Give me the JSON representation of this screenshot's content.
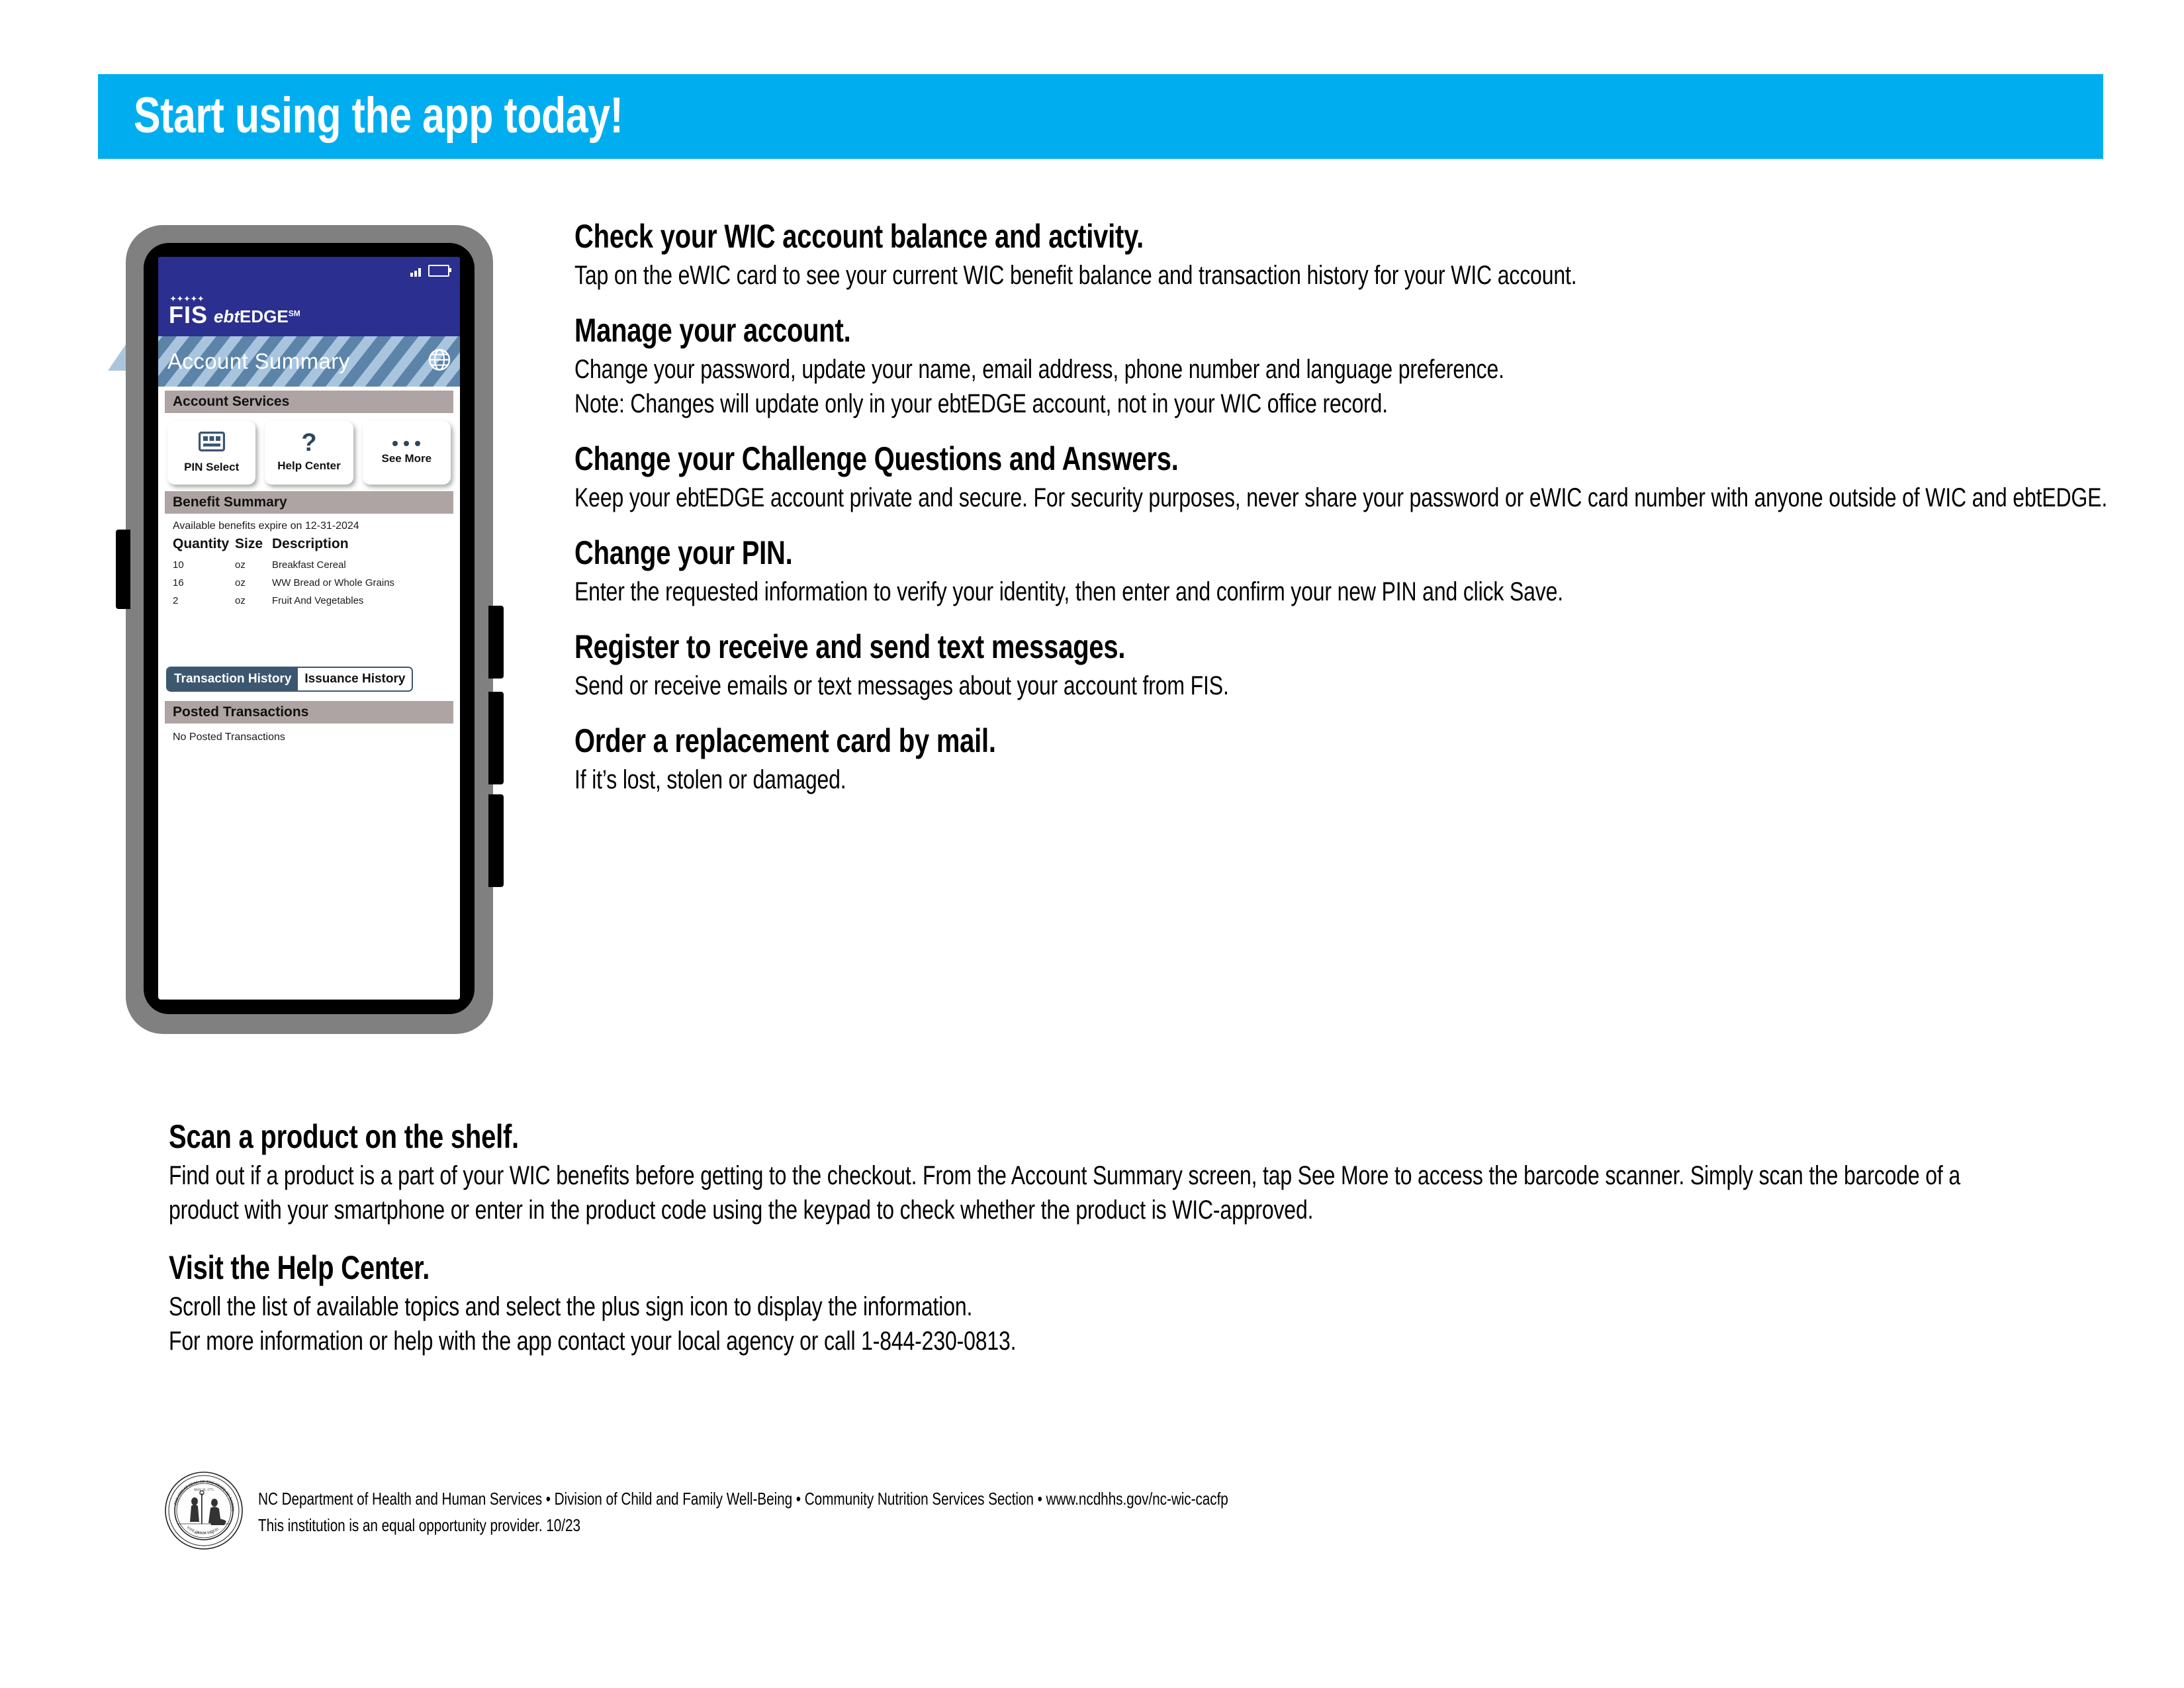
{
  "banner": {
    "title": "Start using the app today!",
    "bg_color": "#00AEEF",
    "text_color": "#FFFFFF"
  },
  "phone": {
    "device_label": "smartphone-mockup",
    "screen": {
      "app_header": {
        "brand": "FIS",
        "product_prefix": "ebt",
        "product_suffix": "EDGE",
        "service_mark": "SM",
        "bg_color": "#2B2F8F",
        "status": {
          "signal": "signal-bars-icon",
          "battery": "battery-icon"
        }
      },
      "page_title": "Account Summary",
      "language_icon": "globe-icon",
      "account_services": {
        "header": "Account Services",
        "tiles": [
          {
            "label": "PIN Select",
            "icon": "keypad-card-icon"
          },
          {
            "label": "Help Center",
            "icon": "question-mark-icon"
          },
          {
            "label": "See More",
            "icon": "ellipsis-icon"
          }
        ]
      },
      "benefit_summary": {
        "header": "Benefit Summary",
        "expiration_note": "Available benefits expire on 12-31-2024",
        "columns": [
          "Quantity",
          "Size",
          "Description"
        ],
        "rows": [
          {
            "quantity": "10",
            "size": "oz",
            "description": "Breakfast Cereal"
          },
          {
            "quantity": "16",
            "size": "oz",
            "description": "WW Bread or Whole Grains"
          },
          {
            "quantity": "2",
            "size": "oz",
            "description": "Fruit And Vegetables"
          }
        ]
      },
      "history_tabs": [
        {
          "label": "Transaction History",
          "active": true
        },
        {
          "label": "Issuance History",
          "active": false
        }
      ],
      "posted_transactions": {
        "header": "Posted Transactions",
        "empty_message": "No Posted Transactions"
      },
      "colors": {
        "header_blue": "#2B2F8F",
        "band_dark": "#5C83A8",
        "band_light": "#A9C5DE",
        "section_gray": "#AFA4A4",
        "tab_active": "#3C5770"
      }
    }
  },
  "sections": [
    {
      "heading": "Check your WIC account balance and activity.",
      "body": "Tap on the eWIC card to see your current WIC benefit balance and transaction history for your WIC account."
    },
    {
      "heading": "Manage your account.",
      "body_line1": "Change your password, update your name, email address, phone number and language preference.",
      "body_line2": "Note: Changes will update only in your ebtEDGE account, not in your WIC office record."
    },
    {
      "heading": "Change your Challenge Questions and Answers.",
      "body": "Keep your ebtEDGE account private and secure.  For security purposes, never share your password or eWIC card number with anyone outside of WIC and ebtEDGE."
    },
    {
      "heading": "Change your PIN.",
      "body": "Enter the requested information to verify your identity, then enter and confirm your new PIN and click Save."
    },
    {
      "heading": "Register to receive and send text messages.",
      "body": "Send or receive emails or text messages about your account from FIS."
    },
    {
      "heading": "Order a replacement card by mail.",
      "body": "If it’s lost, stolen or damaged."
    }
  ],
  "bottom_sections": [
    {
      "heading": "Scan a product on the shelf.",
      "body": "Find out if a product is a part of your WIC benefits before getting to the checkout. From the Account Summary screen, tap See More to access the barcode scanner. Simply scan the barcode of a product with your smartphone or enter in the product code using the keypad to check whether the product is WIC-approved."
    },
    {
      "heading": "Visit the Help Center.",
      "body_line1": "Scroll the list of available topics and select the plus sign icon to display the information.",
      "body_line2": "For more information or help with the app contact your local agency or call 1-844-230-0813."
    }
  ],
  "footer": {
    "seal_icon": "nc-state-seal-icon",
    "line1": "NC Department of Health and Human Services • Division of Child and Family Well-Being • Community Nutrition Services Section • www.ncdhhs.gov/nc-wic-cacfp",
    "line2": "This institution is an equal opportunity provider. 10/23"
  }
}
